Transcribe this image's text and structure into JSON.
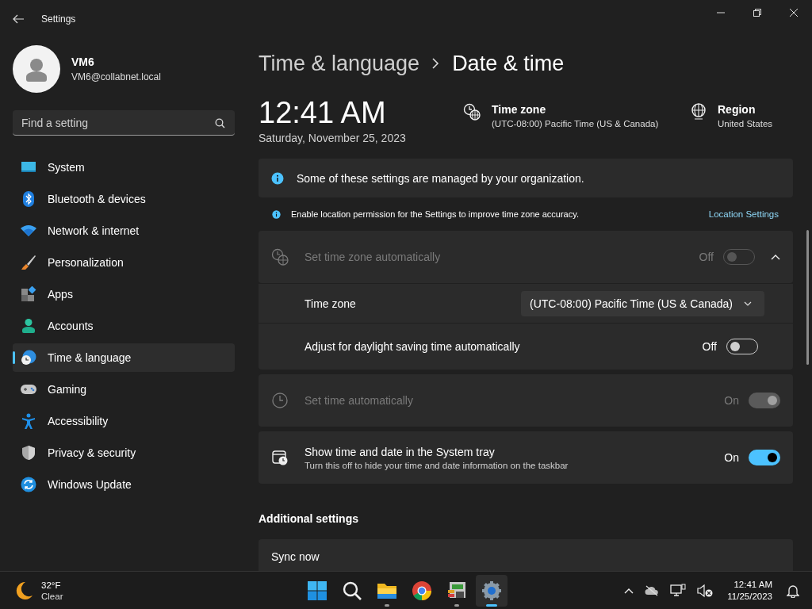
{
  "window": {
    "title": "Settings"
  },
  "user": {
    "name": "VM6",
    "email": "VM6@collabnet.local"
  },
  "search": {
    "placeholder": "Find a setting"
  },
  "nav": [
    {
      "label": "System",
      "selected": false
    },
    {
      "label": "Bluetooth & devices",
      "selected": false
    },
    {
      "label": "Network & internet",
      "selected": false
    },
    {
      "label": "Personalization",
      "selected": false
    },
    {
      "label": "Apps",
      "selected": false
    },
    {
      "label": "Accounts",
      "selected": false
    },
    {
      "label": "Time & language",
      "selected": true
    },
    {
      "label": "Gaming",
      "selected": false
    },
    {
      "label": "Accessibility",
      "selected": false
    },
    {
      "label": "Privacy & security",
      "selected": false
    },
    {
      "label": "Windows Update",
      "selected": false
    }
  ],
  "breadcrumb": {
    "parent": "Time & language",
    "current": "Date & time"
  },
  "clock": {
    "time": "12:41 AM",
    "date": "Saturday, November 25, 2023"
  },
  "summary": [
    {
      "title": "Time zone",
      "value": "(UTC-08:00) Pacific Time (US & Canada)"
    },
    {
      "title": "Region",
      "value": "United States"
    }
  ],
  "notice": "Some of these settings are managed by your organization.",
  "location_hint": {
    "text": "Enable location permission for the Settings to improve time zone accuracy.",
    "link": "Location Settings"
  },
  "groups": [
    {
      "kind": "expander",
      "label": "Set time zone automatically",
      "disabled": true,
      "on": false,
      "state_label": "Off",
      "expanded": true,
      "children": [
        {
          "kind": "dropdown",
          "label": "Time zone",
          "value": "(UTC-08:00) Pacific Time (US & Canada)"
        },
        {
          "kind": "toggle",
          "label": "Adjust for daylight saving time automatically",
          "disabled": false,
          "on": false,
          "state_label": "Off"
        }
      ]
    },
    {
      "kind": "toggle",
      "label": "Set time automatically",
      "disabled": true,
      "on": true,
      "state_label": "On"
    },
    {
      "kind": "toggle",
      "label": "Show time and date in the System tray",
      "description": "Turn this off to hide your time and date information on the taskbar",
      "disabled": false,
      "on": true,
      "state_label": "On"
    }
  ],
  "additional": {
    "title": "Additional settings",
    "sync_title": "Sync now"
  },
  "taskbar": {
    "weather": {
      "temp": "32°F",
      "condition": "Clear"
    },
    "apps": [
      {
        "running": false,
        "active": false
      },
      {
        "running": false,
        "active": false
      },
      {
        "running": true,
        "active": false
      },
      {
        "running": false,
        "active": false
      },
      {
        "running": true,
        "active": false
      },
      {
        "running": true,
        "active": true
      }
    ],
    "time": "12:41 AM",
    "date": "11/25/2023"
  }
}
